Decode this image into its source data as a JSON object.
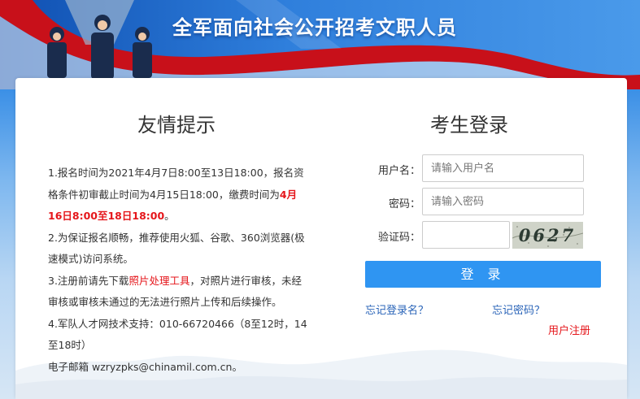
{
  "banner": {
    "title": "全军面向社会公开招考文职人员"
  },
  "notice": {
    "title": "友情提示",
    "item1_pre": "1.报名时间为2021年4月7日8:00至13日18:00，报名资格条件初审截止时间为4月15日18:00，缴费时间为",
    "item1_red": "4月16日8:00至18日18:00",
    "item1_post": "。",
    "item2": "2.为保证报名顺畅，推荐使用火狐、谷歌、360浏览器(极速模式)访问系统。",
    "item3_pre": "3.注册前请先下载",
    "item3_link": "照片处理工具",
    "item3_post": "，对照片进行审核，未经审核或审核未通过的无法进行照片上传和后续操作。",
    "item4": "4.军队人才网技术支持：010-66720466（8至12时，14至18时）",
    "email": "电子邮箱 wzryzpks@chinamil.com.cn。"
  },
  "login": {
    "title": "考生登录",
    "username_label": "用户名：",
    "username_placeholder": "请输入用户名",
    "password_label": "密码：",
    "password_placeholder": "请输入密码",
    "captcha_label": "验证码：",
    "captcha_text": "0627",
    "submit_label": "登 录",
    "forgot_username": "忘记登录名？",
    "forgot_password": "忘记密码？",
    "register": "用户注册"
  },
  "colors": {
    "accent_blue": "#2f95f2",
    "link_blue": "#2a64b8",
    "alert_red": "#e5161b"
  }
}
